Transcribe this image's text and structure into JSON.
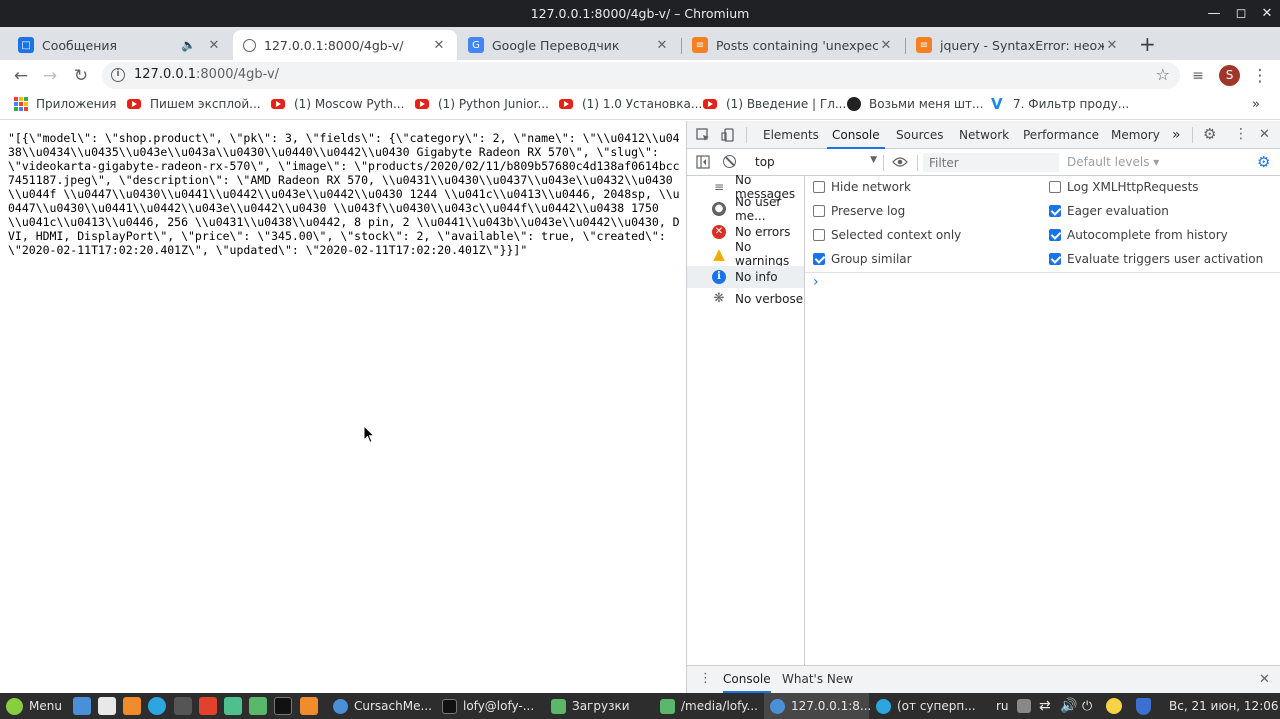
{
  "window": {
    "title": "127.0.0.1:8000/4gb-v/ – Chromium"
  },
  "tabs": [
    {
      "label": "Сообщения"
    },
    {
      "label": "127.0.0.1:8000/4gb-v/"
    },
    {
      "label": "Google Переводчик"
    },
    {
      "label": "Posts containing 'unexpected"
    },
    {
      "label": "jquery - SyntaxError: неожида"
    }
  ],
  "toolbar": {
    "url_host": "127.0.0.1",
    "url_rest": ":8000/4gb-v/",
    "avatar_letter": "S"
  },
  "bookmarks": [
    {
      "label": "Приложения"
    },
    {
      "label": "Пишем эксплой..."
    },
    {
      "label": "(1) Moscow Pyth..."
    },
    {
      "label": "(1) Python Junior..."
    },
    {
      "label": "(1) 1.0 Установка..."
    },
    {
      "label": "(1) Введение | Гл..."
    },
    {
      "label": "Возьми меня шт..."
    },
    {
      "label": "7. Фильтр проду..."
    }
  ],
  "page": {
    "json_text": "\"[{\\\"model\\\": \\\"shop.product\\\", \\\"pk\\\": 3, \\\"fields\\\": {\\\"category\\\": 2, \\\"name\\\": \\\"\\\\u0412\\\\u0438\\\\u0434\\\\u0435\\\\u043e\\\\u043a\\\\u0430\\\\u0440\\\\u0442\\\\u0430 Gigabyte Radeon RX 570\\\", \\\"slug\\\": \\\"videokarta-gigabyte-radeon-rx-570\\\", \\\"image\\\": \\\"products/2020/02/11/b809b57680c4d138af0614bcc7451187.jpeg\\\", \\\"description\\\": \\\"AMD Radeon RX 570, \\\\u0431\\\\u0430\\\\u0437\\\\u043e\\\\u0432\\\\u0430\\\\u044f \\\\u0447\\\\u0430\\\\u0441\\\\u0442\\\\u043e\\\\u0442\\\\u0430 1244 \\\\u041c\\\\u0413\\\\u0446, 2048sp, \\\\u0447\\\\u0430\\\\u0441\\\\u0442\\\\u043e\\\\u0442\\\\u0430 \\\\u043f\\\\u0430\\\\u043c\\\\u044f\\\\u0442\\\\u0438 1750 \\\\u041c\\\\u0413\\\\u0446, 256 \\\\u0431\\\\u0438\\\\u0442, 8 pin, 2 \\\\u0441\\\\u043b\\\\u043e\\\\u0442\\\\u0430, DVI, HDMI, DisplayPort\\\", \\\"price\\\": \\\"345.00\\\", \\\"stock\\\": 2, \\\"available\\\": true, \\\"created\\\": \\\"2020-02-11T17:02:20.401Z\\\", \\\"updated\\\": \\\"2020-02-11T17:02:20.401Z\\\"}}]\""
  },
  "devtools": {
    "tabs": [
      "Elements",
      "Console",
      "Sources",
      "Network",
      "Performance",
      "Memory"
    ],
    "active_tab": "Console",
    "more_tabs": "»",
    "context": "top",
    "filter_placeholder": "Filter",
    "levels": "Default levels ▾",
    "sidebar": [
      {
        "label": "No messages"
      },
      {
        "label": "No user me..."
      },
      {
        "label": "No errors"
      },
      {
        "label": "No warnings"
      },
      {
        "label": "No info"
      },
      {
        "label": "No verbose"
      }
    ],
    "settings": [
      {
        "label": "Hide network",
        "checked": false
      },
      {
        "label": "Log XMLHttpRequests",
        "checked": false
      },
      {
        "label": "Preserve log",
        "checked": false
      },
      {
        "label": "Eager evaluation",
        "checked": true
      },
      {
        "label": "Selected context only",
        "checked": false
      },
      {
        "label": "Autocomplete from history",
        "checked": true
      },
      {
        "label": "Group similar",
        "checked": true
      },
      {
        "label": "Evaluate triggers user activation",
        "checked": true
      }
    ],
    "prompt": "›",
    "drawer_tabs": [
      "Console",
      "What's New"
    ]
  },
  "taskbar": {
    "menu_label": "Menu",
    "windows": [
      {
        "label": "CursachMe..."
      },
      {
        "label": "lofy@lofy-..."
      },
      {
        "label": "Загрузки"
      },
      {
        "label": "/media/lofy..."
      },
      {
        "label": "127.0.0.1:8..."
      },
      {
        "label": "(от суперп..."
      }
    ],
    "lang": "ru",
    "clock": "Вс, 21 июн, 12:06"
  }
}
